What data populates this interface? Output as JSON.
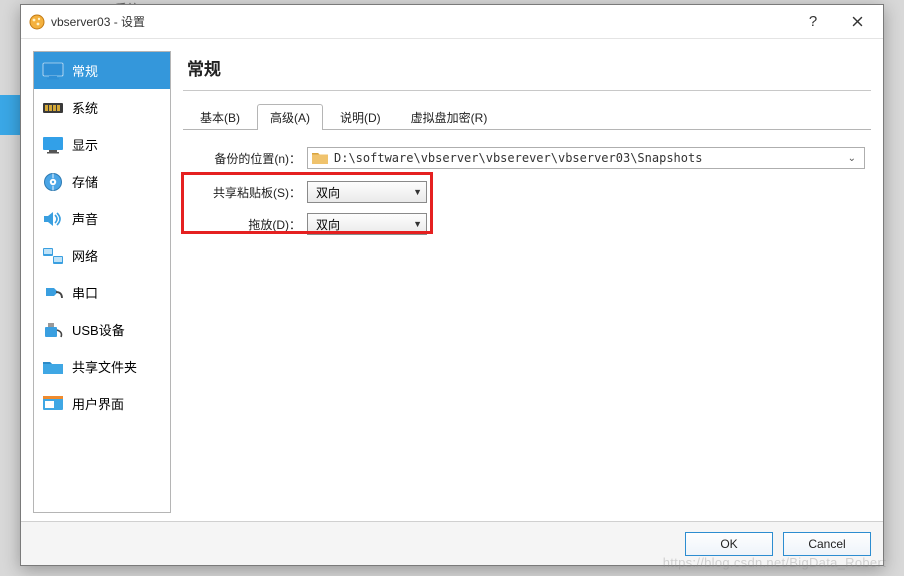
{
  "window": {
    "title": "vbserver03 - 设置",
    "help": "?",
    "close": "×"
  },
  "sidebar": {
    "items": [
      {
        "id": "general",
        "label": "常规"
      },
      {
        "id": "system",
        "label": "系统"
      },
      {
        "id": "display",
        "label": "显示"
      },
      {
        "id": "storage",
        "label": "存储"
      },
      {
        "id": "audio",
        "label": "声音"
      },
      {
        "id": "network",
        "label": "网络"
      },
      {
        "id": "serial",
        "label": "串口"
      },
      {
        "id": "usb",
        "label": "USB设备"
      },
      {
        "id": "shared",
        "label": "共享文件夹"
      },
      {
        "id": "ui",
        "label": "用户界面"
      }
    ]
  },
  "main": {
    "title": "常规",
    "tabs": [
      {
        "label": "基本(B)"
      },
      {
        "label": "高级(A)"
      },
      {
        "label": "说明(D)"
      },
      {
        "label": "虚拟盘加密(R)"
      }
    ],
    "active_tab": 1,
    "fields": {
      "backup_label": "备份的位置(n)：",
      "backup_path": "D:\\software\\vbserver\\vbserever\\vbserver03\\Snapshots",
      "clipboard_label": "共享粘贴板(S)：",
      "clipboard_value": "双向",
      "dragdrop_label": "拖放(D)：",
      "dragdrop_value": "双向"
    }
  },
  "buttons": {
    "ok": "OK",
    "cancel": "Cancel"
  },
  "watermark": "https://blog.csdn.net/BigData_Robert",
  "bg_hint": "系统"
}
